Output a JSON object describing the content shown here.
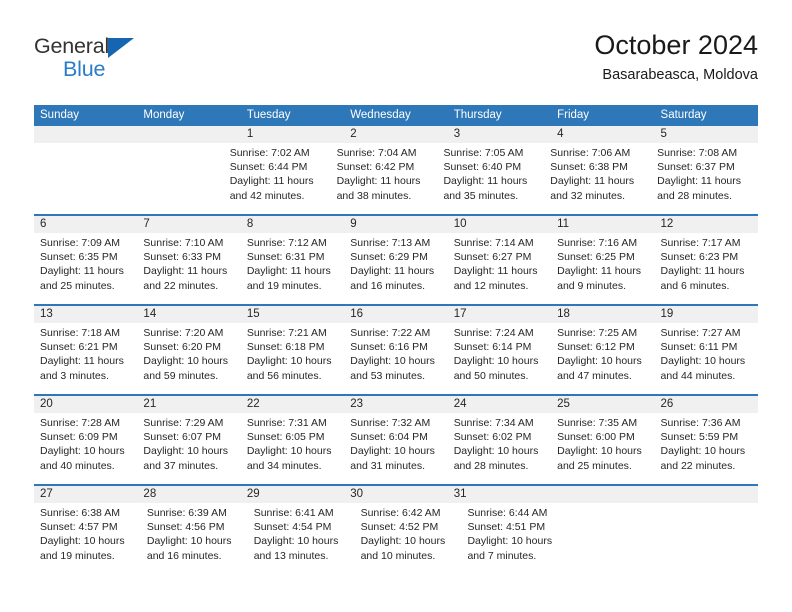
{
  "brand": {
    "name_top": "General",
    "name_bottom": "Blue",
    "triangle_color": "#1565b0",
    "blue_color": "#2a7cc7"
  },
  "header": {
    "title": "October 2024",
    "subtitle": "Basarabeasca, Moldova"
  },
  "theme": {
    "header_blue": "#2e77b8",
    "date_strip_gray": "#f0f0f0",
    "text_color": "#262626"
  },
  "calendar": {
    "day_headers": [
      "Sunday",
      "Monday",
      "Tuesday",
      "Wednesday",
      "Thursday",
      "Friday",
      "Saturday"
    ],
    "weeks": [
      [
        {
          "day": "",
          "empty": true
        },
        {
          "day": "",
          "empty": true
        },
        {
          "day": "1",
          "sunrise": "Sunrise: 7:02 AM",
          "sunset": "Sunset: 6:44 PM",
          "daylight": "Daylight: 11 hours and 42 minutes."
        },
        {
          "day": "2",
          "sunrise": "Sunrise: 7:04 AM",
          "sunset": "Sunset: 6:42 PM",
          "daylight": "Daylight: 11 hours and 38 minutes."
        },
        {
          "day": "3",
          "sunrise": "Sunrise: 7:05 AM",
          "sunset": "Sunset: 6:40 PM",
          "daylight": "Daylight: 11 hours and 35 minutes."
        },
        {
          "day": "4",
          "sunrise": "Sunrise: 7:06 AM",
          "sunset": "Sunset: 6:38 PM",
          "daylight": "Daylight: 11 hours and 32 minutes."
        },
        {
          "day": "5",
          "sunrise": "Sunrise: 7:08 AM",
          "sunset": "Sunset: 6:37 PM",
          "daylight": "Daylight: 11 hours and 28 minutes."
        }
      ],
      [
        {
          "day": "6",
          "sunrise": "Sunrise: 7:09 AM",
          "sunset": "Sunset: 6:35 PM",
          "daylight": "Daylight: 11 hours and 25 minutes."
        },
        {
          "day": "7",
          "sunrise": "Sunrise: 7:10 AM",
          "sunset": "Sunset: 6:33 PM",
          "daylight": "Daylight: 11 hours and 22 minutes."
        },
        {
          "day": "8",
          "sunrise": "Sunrise: 7:12 AM",
          "sunset": "Sunset: 6:31 PM",
          "daylight": "Daylight: 11 hours and 19 minutes."
        },
        {
          "day": "9",
          "sunrise": "Sunrise: 7:13 AM",
          "sunset": "Sunset: 6:29 PM",
          "daylight": "Daylight: 11 hours and 16 minutes."
        },
        {
          "day": "10",
          "sunrise": "Sunrise: 7:14 AM",
          "sunset": "Sunset: 6:27 PM",
          "daylight": "Daylight: 11 hours and 12 minutes."
        },
        {
          "day": "11",
          "sunrise": "Sunrise: 7:16 AM",
          "sunset": "Sunset: 6:25 PM",
          "daylight": "Daylight: 11 hours and 9 minutes."
        },
        {
          "day": "12",
          "sunrise": "Sunrise: 7:17 AM",
          "sunset": "Sunset: 6:23 PM",
          "daylight": "Daylight: 11 hours and 6 minutes."
        }
      ],
      [
        {
          "day": "13",
          "sunrise": "Sunrise: 7:18 AM",
          "sunset": "Sunset: 6:21 PM",
          "daylight": "Daylight: 11 hours and 3 minutes."
        },
        {
          "day": "14",
          "sunrise": "Sunrise: 7:20 AM",
          "sunset": "Sunset: 6:20 PM",
          "daylight": "Daylight: 10 hours and 59 minutes."
        },
        {
          "day": "15",
          "sunrise": "Sunrise: 7:21 AM",
          "sunset": "Sunset: 6:18 PM",
          "daylight": "Daylight: 10 hours and 56 minutes."
        },
        {
          "day": "16",
          "sunrise": "Sunrise: 7:22 AM",
          "sunset": "Sunset: 6:16 PM",
          "daylight": "Daylight: 10 hours and 53 minutes."
        },
        {
          "day": "17",
          "sunrise": "Sunrise: 7:24 AM",
          "sunset": "Sunset: 6:14 PM",
          "daylight": "Daylight: 10 hours and 50 minutes."
        },
        {
          "day": "18",
          "sunrise": "Sunrise: 7:25 AM",
          "sunset": "Sunset: 6:12 PM",
          "daylight": "Daylight: 10 hours and 47 minutes."
        },
        {
          "day": "19",
          "sunrise": "Sunrise: 7:27 AM",
          "sunset": "Sunset: 6:11 PM",
          "daylight": "Daylight: 10 hours and 44 minutes."
        }
      ],
      [
        {
          "day": "20",
          "sunrise": "Sunrise: 7:28 AM",
          "sunset": "Sunset: 6:09 PM",
          "daylight": "Daylight: 10 hours and 40 minutes."
        },
        {
          "day": "21",
          "sunrise": "Sunrise: 7:29 AM",
          "sunset": "Sunset: 6:07 PM",
          "daylight": "Daylight: 10 hours and 37 minutes."
        },
        {
          "day": "22",
          "sunrise": "Sunrise: 7:31 AM",
          "sunset": "Sunset: 6:05 PM",
          "daylight": "Daylight: 10 hours and 34 minutes."
        },
        {
          "day": "23",
          "sunrise": "Sunrise: 7:32 AM",
          "sunset": "Sunset: 6:04 PM",
          "daylight": "Daylight: 10 hours and 31 minutes."
        },
        {
          "day": "24",
          "sunrise": "Sunrise: 7:34 AM",
          "sunset": "Sunset: 6:02 PM",
          "daylight": "Daylight: 10 hours and 28 minutes."
        },
        {
          "day": "25",
          "sunrise": "Sunrise: 7:35 AM",
          "sunset": "Sunset: 6:00 PM",
          "daylight": "Daylight: 10 hours and 25 minutes."
        },
        {
          "day": "26",
          "sunrise": "Sunrise: 7:36 AM",
          "sunset": "Sunset: 5:59 PM",
          "daylight": "Daylight: 10 hours and 22 minutes."
        }
      ],
      [
        {
          "day": "27",
          "sunrise": "Sunrise: 6:38 AM",
          "sunset": "Sunset: 4:57 PM",
          "daylight": "Daylight: 10 hours and 19 minutes."
        },
        {
          "day": "28",
          "sunrise": "Sunrise: 6:39 AM",
          "sunset": "Sunset: 4:56 PM",
          "daylight": "Daylight: 10 hours and 16 minutes."
        },
        {
          "day": "29",
          "sunrise": "Sunrise: 6:41 AM",
          "sunset": "Sunset: 4:54 PM",
          "daylight": "Daylight: 10 hours and 13 minutes."
        },
        {
          "day": "30",
          "sunrise": "Sunrise: 6:42 AM",
          "sunset": "Sunset: 4:52 PM",
          "daylight": "Daylight: 10 hours and 10 minutes."
        },
        {
          "day": "31",
          "sunrise": "Sunrise: 6:44 AM",
          "sunset": "Sunset: 4:51 PM",
          "daylight": "Daylight: 10 hours and 7 minutes."
        },
        {
          "day": "",
          "empty": true
        },
        {
          "day": "",
          "empty": true
        }
      ]
    ]
  }
}
